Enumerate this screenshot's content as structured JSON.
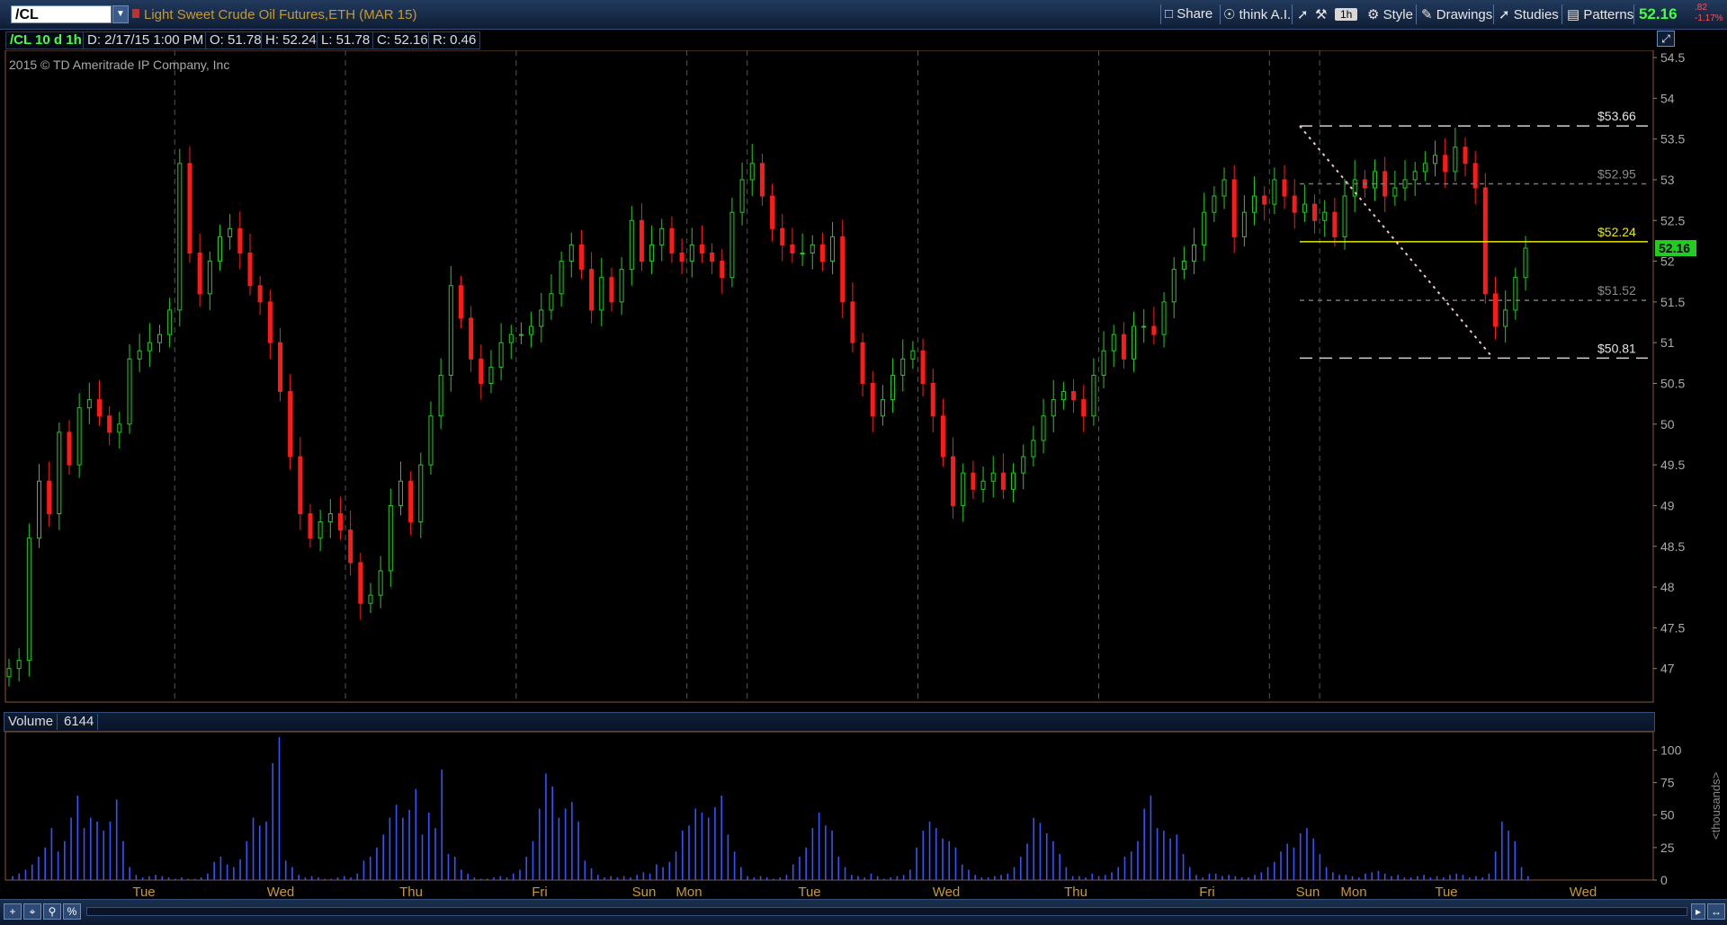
{
  "toolbar": {
    "symbol": "/CL",
    "description": "Light Sweet Crude Oil Futures,ETH (MAR 15)",
    "share_label": "Share",
    "think_label": "think A.I.",
    "timeframe_label": "1h",
    "style_label": "Style",
    "drawings_label": "Drawings",
    "studies_label": "Studies",
    "patterns_label": "Patterns",
    "last_price": "52.16",
    "change": ".82",
    "change_pct": "-1.17%"
  },
  "info_bar": {
    "symbol_period": "/CL 10 d 1h",
    "date": "D: 2/17/15 1:00 PM",
    "open": "O: 51.78",
    "high": "H: 52.24",
    "low": "L: 51.78",
    "close": "C: 52.16",
    "range": "R: 0.46"
  },
  "copyright": "2015 © TD Ameritrade IP Company, Inc",
  "volume_panel": {
    "label": "Volume",
    "value": "6144",
    "units_label": "<thousands>"
  },
  "colors": {
    "up": "#22cc22",
    "down": "#ff1a1a",
    "volume": "#3355ff",
    "price_tag": "#22cc22",
    "fib_main": "#e8e800"
  },
  "chart_data": [
    {
      "type": "candlestick",
      "title": "",
      "ylim": [
        46.5,
        54.5
      ],
      "y_ticks": [
        47,
        47.5,
        48,
        48.5,
        49,
        49.5,
        50,
        50.5,
        51,
        51.5,
        52,
        52.5,
        53,
        53.5,
        54,
        54.5
      ],
      "x_labels": [
        "Tue",
        "Wed",
        "Thu",
        "Fri",
        "Sun",
        "Mon",
        "Tue",
        "Wed",
        "Thu",
        "Fri",
        "Sun",
        "Mon",
        "Tue",
        "Wed"
      ],
      "current_price_tag": "52.16",
      "fib_levels": [
        {
          "label": "$53.66",
          "value": 53.66
        },
        {
          "label": "$52.95",
          "value": 52.95
        },
        {
          "label": "$52.24",
          "value": 52.24
        },
        {
          "label": "$51.52",
          "value": 51.52
        },
        {
          "label": "$50.81",
          "value": 50.81
        }
      ],
      "close_series": [
        {
          "day": "Tue",
          "values": [
            47.0,
            47.1,
            48.6,
            49.3,
            48.9,
            49.9,
            49.5,
            50.2,
            50.3,
            50.1,
            49.9,
            50.0,
            50.8,
            50.9,
            51.0,
            51.1,
            51.4
          ]
        },
        {
          "day": "Wed",
          "values": [
            53.2,
            52.1,
            51.6,
            52.0,
            52.3,
            52.4,
            52.1,
            51.7,
            51.5,
            51.0,
            50.4,
            49.6,
            48.9,
            48.6,
            48.8,
            48.9,
            48.7
          ]
        },
        {
          "day": "Thu",
          "values": [
            48.3,
            47.8,
            47.9,
            48.2,
            49.0,
            49.3,
            48.8,
            49.5,
            50.1,
            50.6,
            51.7,
            51.3,
            50.8,
            50.5,
            50.7,
            51.0,
            51.1
          ]
        },
        {
          "day": "Fri",
          "values": [
            51.1,
            51.2,
            51.4,
            51.6,
            52.0,
            52.2,
            51.9,
            51.4,
            51.8,
            51.5,
            51.9,
            52.5,
            52.0,
            52.2,
            52.4,
            52.1,
            52.0
          ]
        },
        {
          "day": "Sun",
          "values": [
            52.2,
            52.1,
            52.0,
            51.8,
            52.6,
            53.0
          ]
        },
        {
          "day": "Mon",
          "values": [
            53.2,
            52.8,
            52.4,
            52.2,
            52.1,
            52.1,
            52.2,
            52.0,
            52.3,
            51.5,
            51.0,
            50.5,
            50.1,
            50.3,
            50.6,
            50.8,
            50.9
          ]
        },
        {
          "day": "Tue",
          "values": [
            50.5,
            50.1,
            49.6,
            49.0,
            49.4,
            49.2,
            49.3,
            49.4,
            49.2,
            49.4,
            49.6,
            49.8,
            50.1,
            50.3,
            50.4,
            50.3,
            50.1,
            50.6
          ]
        },
        {
          "day": "Wed",
          "values": [
            50.9,
            51.1,
            50.8,
            51.2,
            51.2,
            51.1,
            51.5,
            51.9,
            52.0,
            52.2,
            52.6,
            52.8,
            53.0,
            52.3,
            52.6,
            52.8,
            52.7
          ]
        },
        {
          "day": "Sun",
          "values": [
            53.0,
            52.8,
            52.6,
            52.7,
            52.5
          ]
        },
        {
          "day": "Mon",
          "values": [
            52.6,
            52.3,
            52.8,
            53.0,
            52.9,
            53.1,
            52.8,
            52.9,
            53.0,
            53.1,
            53.2,
            53.3,
            53.1,
            53.4,
            53.2,
            52.9,
            51.6,
            51.2,
            51.4,
            51.8,
            52.16
          ]
        }
      ]
    },
    {
      "type": "bar",
      "title": "",
      "ylim": [
        0,
        110
      ],
      "y_ticks": [
        0,
        25,
        50,
        75,
        100
      ],
      "y_units": "thousands",
      "values": [
        3,
        5,
        8,
        12,
        18,
        25,
        40,
        22,
        30,
        48,
        65,
        40,
        48,
        45,
        38,
        45,
        62,
        30,
        10,
        4,
        2,
        3,
        4,
        3,
        2,
        1,
        2,
        1,
        1,
        2,
        5,
        14,
        18,
        12,
        10,
        16,
        30,
        48,
        42,
        45,
        90,
        110,
        15,
        10,
        4,
        2,
        3,
        2,
        1,
        1,
        2,
        3,
        2,
        5,
        15,
        18,
        25,
        35,
        48,
        58,
        48,
        54,
        70,
        35,
        52,
        40,
        85,
        20,
        18,
        8,
        5,
        2,
        1,
        1,
        2,
        3,
        2,
        5,
        8,
        18,
        30,
        55,
        82,
        72,
        48,
        55,
        60,
        45,
        15,
        9,
        4,
        2,
        3,
        2,
        3,
        2,
        4,
        6,
        5,
        12,
        10,
        14,
        22,
        38,
        42,
        55,
        52,
        48,
        56,
        65,
        35,
        22,
        10,
        3,
        2,
        3,
        2,
        1,
        2,
        4,
        12,
        18,
        25,
        40,
        52,
        42,
        38,
        18,
        10,
        4,
        3,
        2,
        5,
        3,
        1,
        2,
        3,
        4,
        8,
        25,
        38,
        45,
        40,
        32,
        30,
        25,
        12,
        8,
        4,
        2,
        2,
        3,
        4,
        5,
        10,
        18,
        28,
        48,
        44,
        36,
        30,
        20,
        10,
        3,
        3,
        2,
        5,
        3,
        4,
        6,
        10,
        18,
        22,
        30,
        55,
        65,
        40,
        38,
        32,
        35,
        20,
        10,
        4,
        2,
        5,
        5,
        3,
        4,
        3,
        2,
        2,
        4,
        6,
        10,
        14,
        22,
        28,
        25,
        36,
        40,
        32,
        20,
        10,
        6,
        4,
        4,
        3,
        2,
        5,
        6,
        7,
        5,
        3,
        4,
        2,
        2,
        3,
        4,
        2,
        3,
        2,
        4,
        5,
        4,
        2,
        3,
        2,
        5,
        22,
        45,
        38,
        30,
        10,
        3
      ]
    }
  ]
}
